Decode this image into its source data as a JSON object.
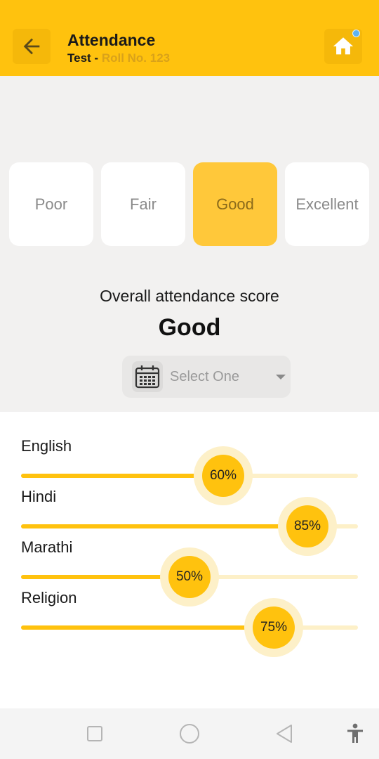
{
  "header": {
    "title": "Attendance",
    "student_name": "Test -",
    "roll_no": "Roll No. 123",
    "back_icon": "arrow-back-icon",
    "home_icon": "home-icon",
    "notification_dot_color": "#5fb3f0"
  },
  "rating": {
    "options": [
      "Poor",
      "Fair",
      "Good",
      "Excellent"
    ],
    "selected": "Good"
  },
  "overall": {
    "caption": "Overall attendance score",
    "value": "Good"
  },
  "period_select": {
    "icon": "calendar-icon",
    "placeholder": "Select One"
  },
  "subjects": [
    {
      "name": "English",
      "percent": 60,
      "label": "60%"
    },
    {
      "name": "Hindi",
      "percent": 85,
      "label": "85%"
    },
    {
      "name": "Marathi",
      "percent": 50,
      "label": "50%"
    },
    {
      "name": "Religion",
      "percent": 75,
      "label": "75%"
    }
  ],
  "colors": {
    "accent": "#ffc20e",
    "selected_card": "#ffc83a",
    "track": "#fdf0c8"
  },
  "navbar": {
    "icons": [
      "recents-square-icon",
      "home-circle-icon",
      "back-triangle-icon",
      "accessibility-icon"
    ]
  }
}
